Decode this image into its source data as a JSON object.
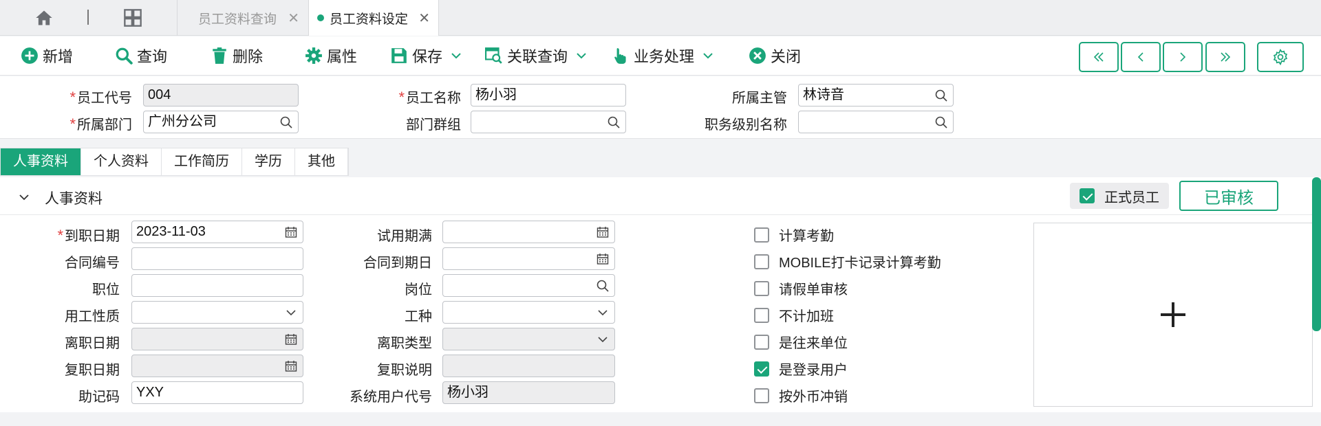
{
  "tabs": [
    {
      "label": "员工资料查询",
      "active": false
    },
    {
      "label": "员工资料设定",
      "active": true
    }
  ],
  "toolbar": {
    "add": "新增",
    "query": "查询",
    "delete": "删除",
    "properties": "属性",
    "save": "保存",
    "linked_query": "关联查询",
    "business": "业务处理",
    "close": "关闭"
  },
  "header": {
    "emp_code_label": "员工代号",
    "emp_code": "004",
    "emp_name_label": "员工名称",
    "emp_name": "杨小羽",
    "manager_label": "所属主管",
    "manager": "林诗音",
    "dept_label": "所属部门",
    "dept": "广州分公司",
    "dept_group_label": "部门群组",
    "dept_group": "",
    "job_level_label": "职务级别名称",
    "job_level": ""
  },
  "subtabs": [
    "人事资料",
    "个人资料",
    "工作简历",
    "学历",
    "其他"
  ],
  "section": {
    "title": "人事资料",
    "formal_label": "正式员工",
    "formal_checked": true,
    "status_badge": "已审核"
  },
  "form": {
    "hire_date_label": "到职日期",
    "hire_date": "2023-11-03",
    "contract_no_label": "合同编号",
    "contract_no": "",
    "position_label": "职位",
    "position": "",
    "employment_type_label": "用工性质",
    "employment_type": "",
    "leave_date_label": "离职日期",
    "leave_date": "",
    "rejoin_date_label": "复职日期",
    "rejoin_date": "",
    "mnemonic_label": "助记码",
    "mnemonic": "YXY",
    "probation_label": "试用期满",
    "probation": "",
    "contract_due_label": "合同到期日",
    "contract_due": "",
    "post_label": "岗位",
    "post": "",
    "work_type_label": "工种",
    "work_type": "",
    "leave_type_label": "离职类型",
    "leave_type": "",
    "rejoin_note_label": "复职说明",
    "rejoin_note": "",
    "sys_user_label": "系统用户代号",
    "sys_user": "杨小羽"
  },
  "checks": [
    {
      "label": "计算考勤",
      "checked": false
    },
    {
      "label": "MOBILE打卡记录计算考勤",
      "checked": false
    },
    {
      "label": "请假单审核",
      "checked": false
    },
    {
      "label": "不计加班",
      "checked": false
    },
    {
      "label": "是往来单位",
      "checked": false
    },
    {
      "label": "是登录用户",
      "checked": true
    },
    {
      "label": "按外币冲销",
      "checked": false
    }
  ],
  "colors": {
    "accent": "#1aa57a",
    "required": "#e04040"
  }
}
